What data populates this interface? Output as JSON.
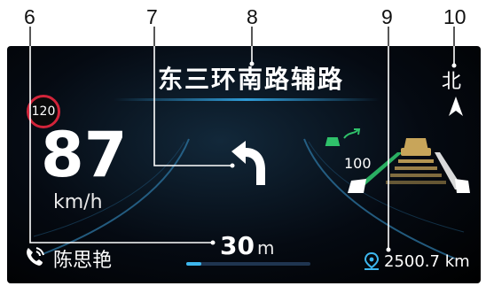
{
  "callouts": [
    "6",
    "7",
    "8",
    "9",
    "10"
  ],
  "hud": {
    "road_name": "东三环南路辅路",
    "heading": "北",
    "speed_limit": "120",
    "speed": "87",
    "speed_unit": "km/h",
    "turn_distance": "30",
    "turn_distance_unit": "m",
    "turn_progress_percent": 12,
    "caller_name": "陈思艳",
    "destination_distance": "2500.7 km",
    "acc_set_speed": "100"
  },
  "icons": {
    "turn": "turn-left-arrow-icon",
    "phone": "phone-call-icon",
    "destination": "location-pin-icon",
    "north": "north-arrow-icon",
    "steering": "steering-assist-icon",
    "lead_car": "lead-car-icon"
  },
  "colors": {
    "accent_blue": "#3db7ee",
    "limit_red": "#d2243a",
    "lane_green": "#2fc16a",
    "lead_car_gold": "#c8a55a"
  }
}
